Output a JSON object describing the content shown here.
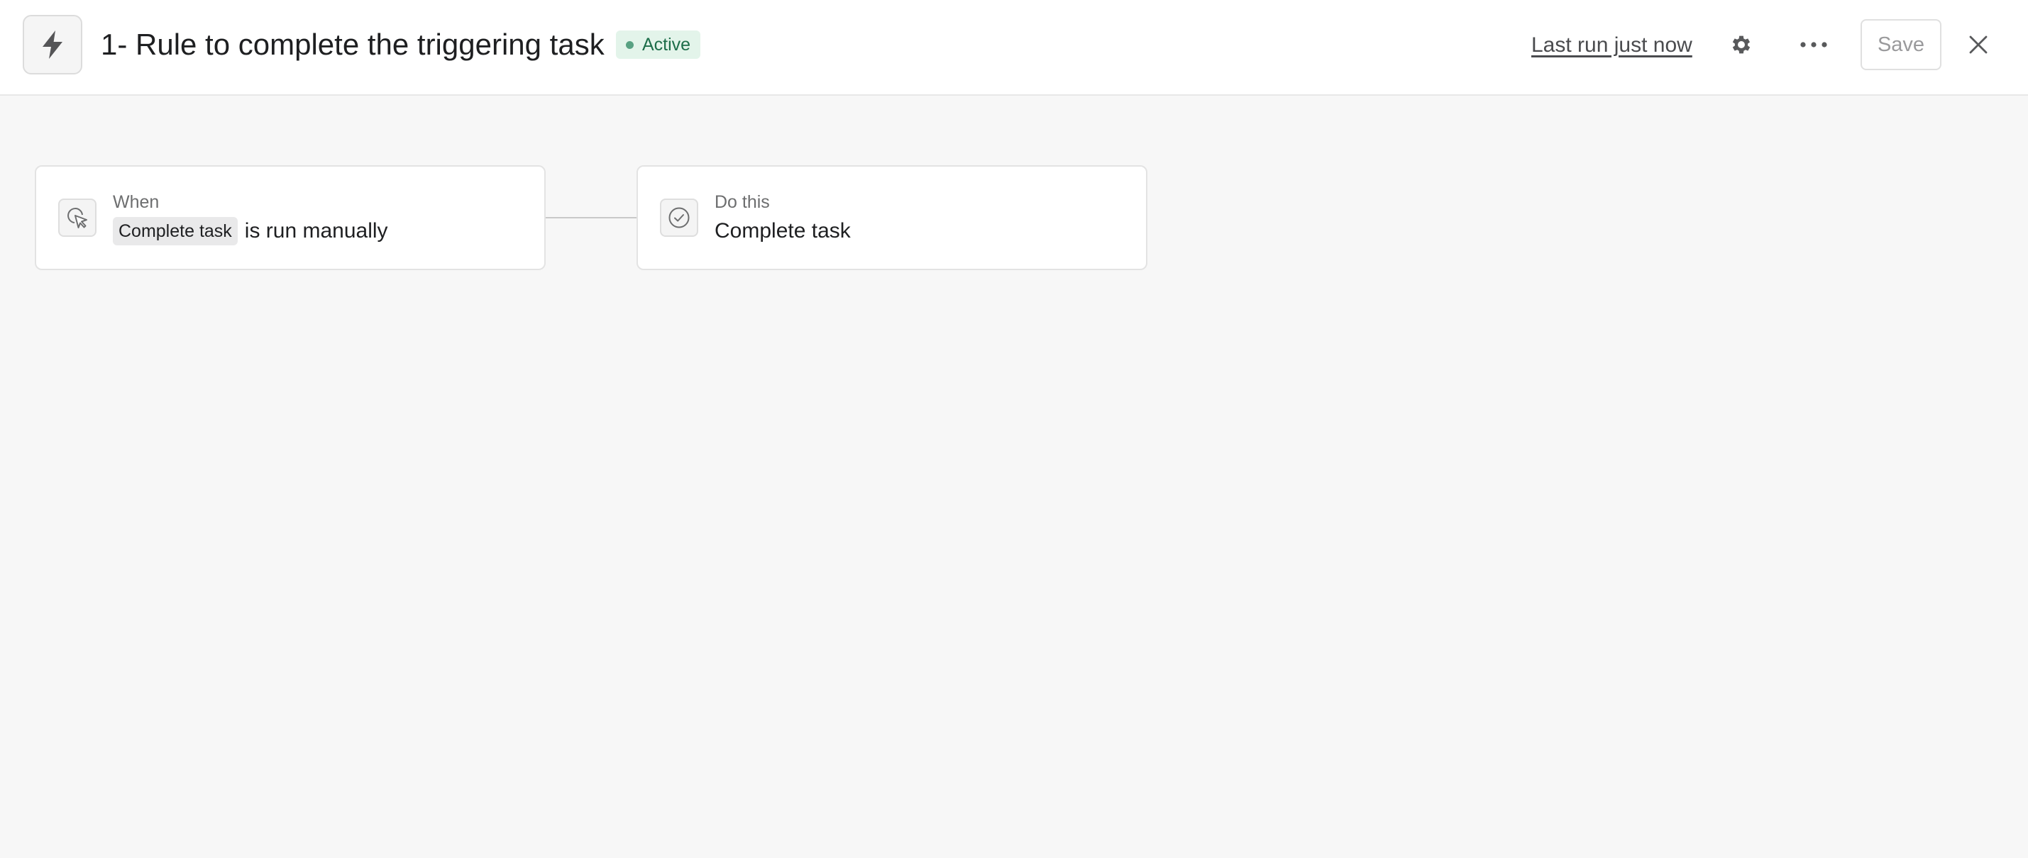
{
  "header": {
    "rule_icon": "lightning-bolt-icon",
    "title": "1- Rule to complete the triggering task",
    "status": {
      "label": "Active",
      "color": "#58a182"
    },
    "last_run": "Last run just now",
    "settings_icon": "gear-icon",
    "more_icon": "more-horizontal-icon",
    "save_label": "Save",
    "close_icon": "close-icon"
  },
  "workflow": {
    "trigger": {
      "icon": "cursor-click-icon",
      "caption": "When",
      "token": "Complete task",
      "text": "is run manually"
    },
    "action": {
      "icon": "check-circle-icon",
      "caption": "Do this",
      "text": "Complete task"
    }
  }
}
